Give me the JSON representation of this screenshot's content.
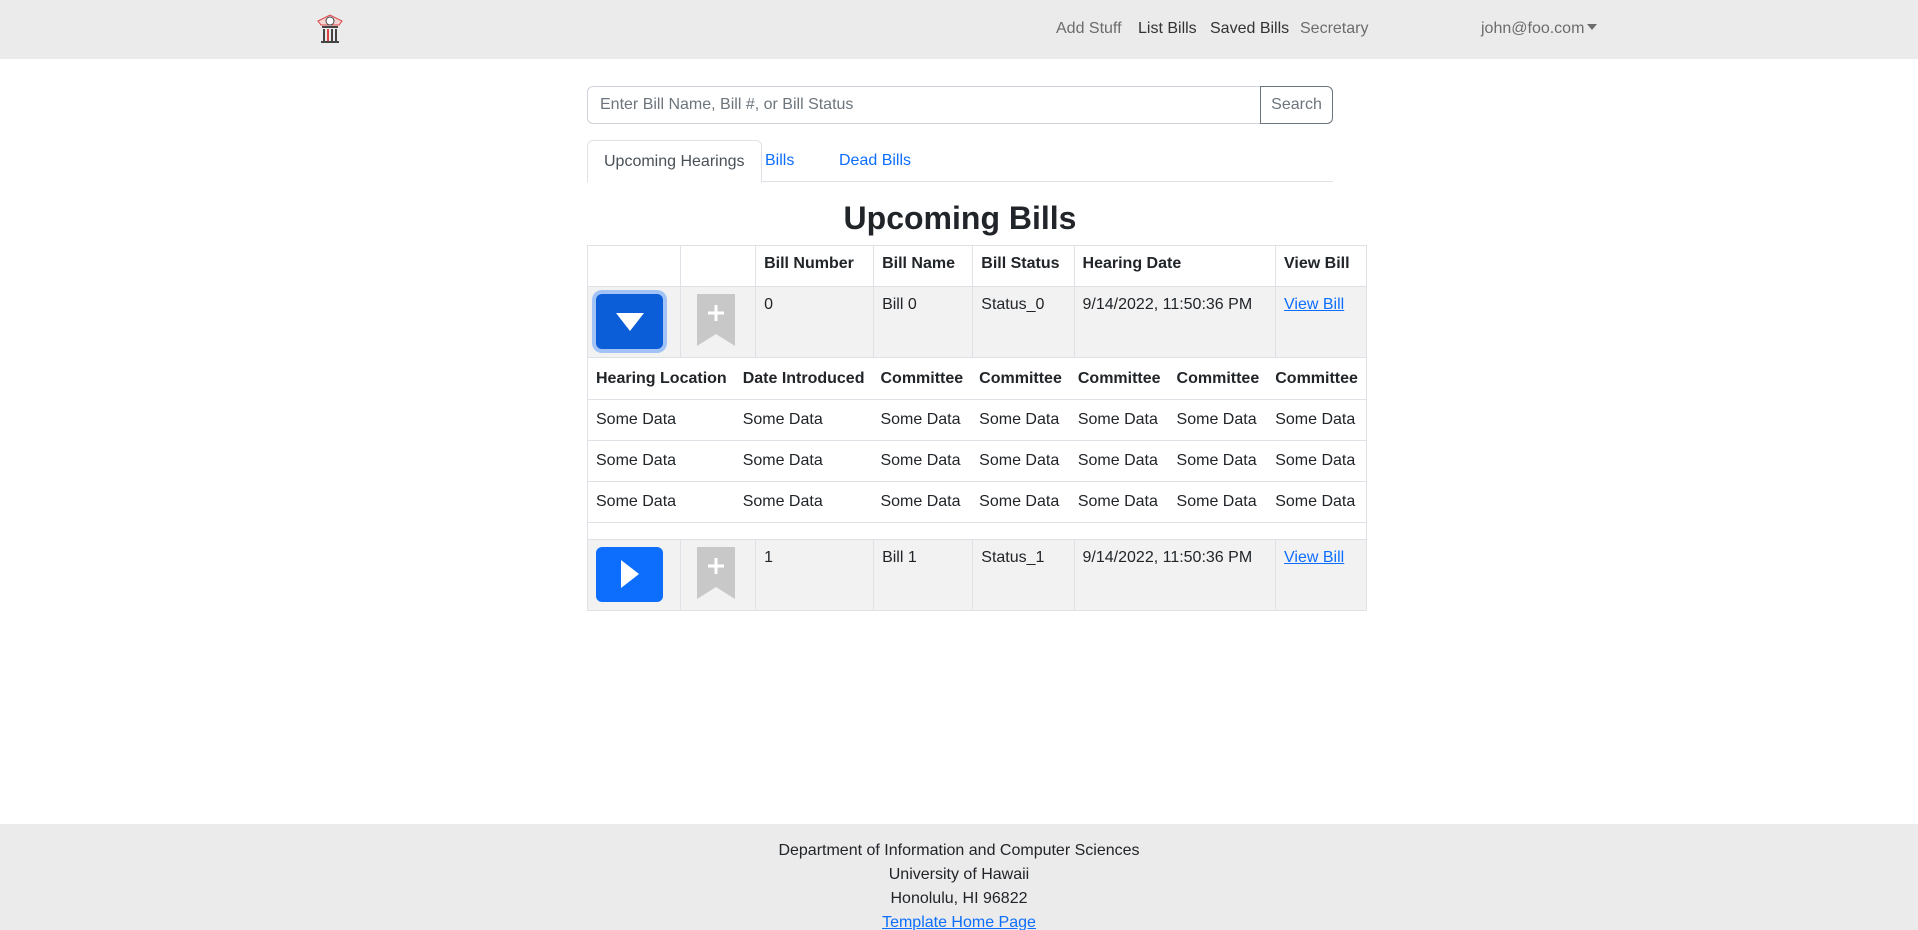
{
  "navbar": {
    "nav": [
      {
        "label": "Add Stuff"
      },
      {
        "label": "List Bills"
      },
      {
        "label": "Saved Bills"
      },
      {
        "label": "Secretary"
      }
    ],
    "user": "john@foo.com"
  },
  "search": {
    "placeholder": "Enter Bill Name, Bill #, or Bill Status",
    "button": "Search"
  },
  "tabs": [
    {
      "label": "Upcoming Hearings",
      "active": true
    },
    {
      "label": "Bills"
    },
    {
      "label": "Dead Bills"
    }
  ],
  "page_title": "Upcoming Bills",
  "table": {
    "headers": [
      "",
      "",
      "Bill Number",
      "Bill Name",
      "Bill Status",
      "Hearing Date",
      "View Bill"
    ],
    "rows": [
      {
        "number": "0",
        "name": "Bill 0",
        "status": "Status_0",
        "hearing_date": "9/14/2022, 11:50:36 PM",
        "link": "View Bill",
        "expanded": true
      },
      {
        "number": "1",
        "name": "Bill 1",
        "status": "Status_1",
        "hearing_date": "9/14/2022, 11:50:36 PM",
        "link": "View Bill",
        "expanded": false
      }
    ],
    "detail": {
      "headers": [
        "Hearing Location",
        "Date Introduced",
        "Committee",
        "Committee",
        "Committee",
        "Committee",
        "Committee"
      ],
      "rows": [
        [
          "Some Data",
          "Some Data",
          "Some Data",
          "Some Data",
          "Some Data",
          "Some Data",
          "Some Data"
        ],
        [
          "Some Data",
          "Some Data",
          "Some Data",
          "Some Data",
          "Some Data",
          "Some Data",
          "Some Data"
        ],
        [
          "Some Data",
          "Some Data",
          "Some Data",
          "Some Data",
          "Some Data",
          "Some Data",
          "Some Data"
        ]
      ]
    }
  },
  "footer": {
    "lines": [
      "Department of Information and Computer Sciences",
      "University of Hawaii",
      "Honolulu, HI 96822"
    ],
    "link": "Template Home Page"
  },
  "colors": {
    "primary": "#0d6efd",
    "navbar_bg": "#ebebeb",
    "bookmark_gray": "#c8c8c8"
  },
  "icons": {
    "logo": "capitol-logo-icon",
    "expanded_toggle": "triangle-down-icon",
    "collapsed_toggle": "triangle-right-icon",
    "bookmark": "bookmark-plus-icon"
  }
}
